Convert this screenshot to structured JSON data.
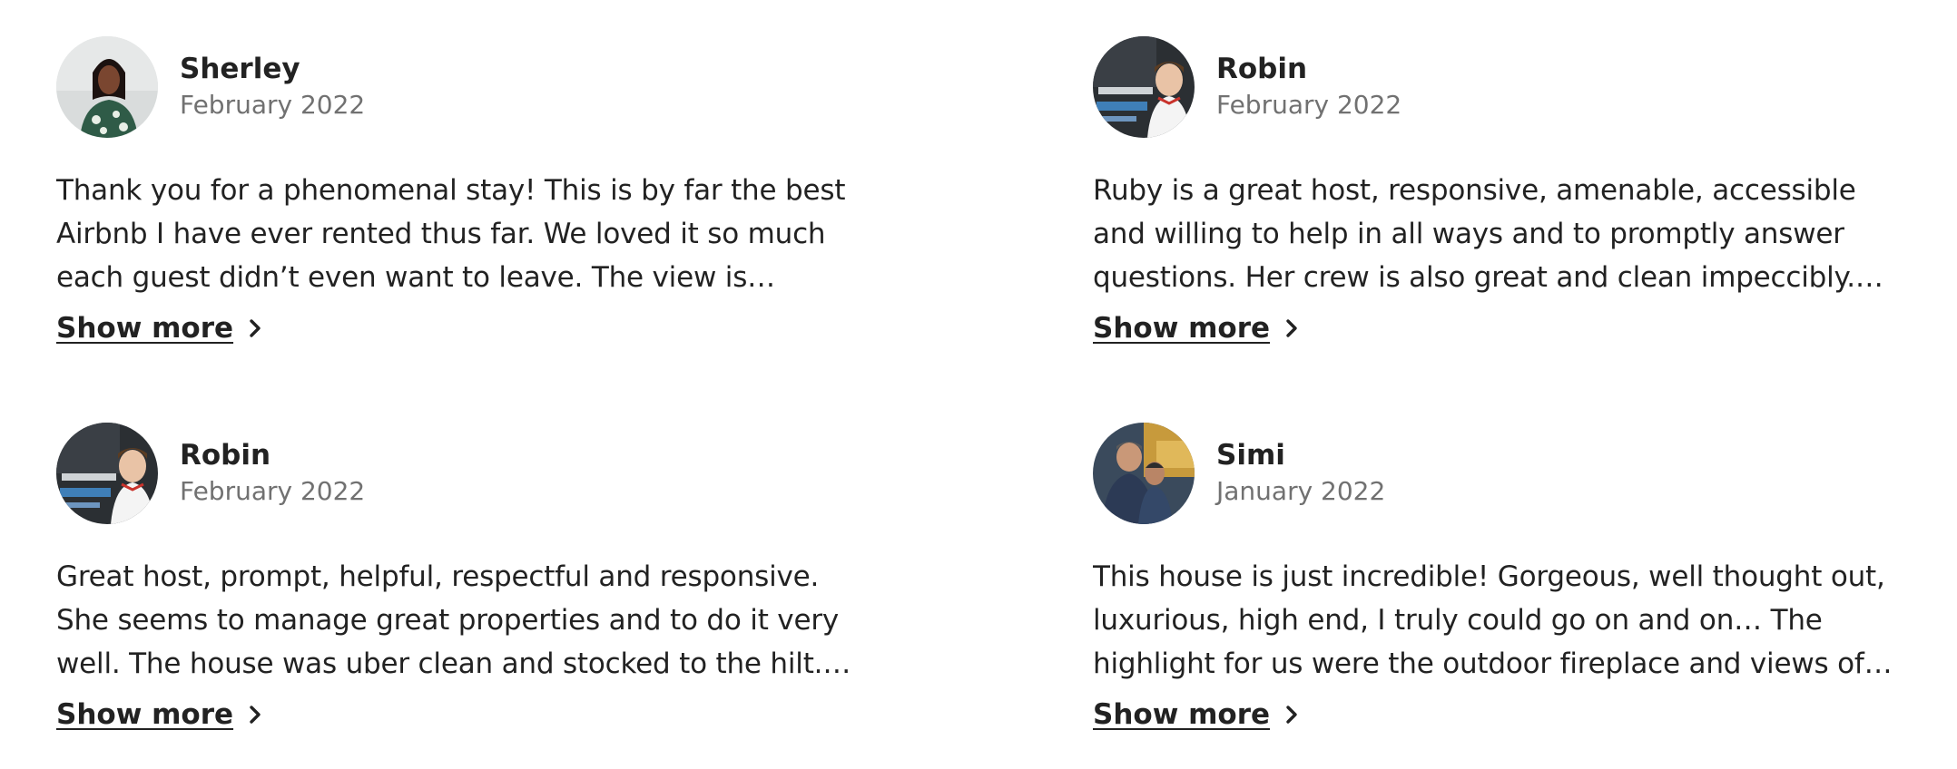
{
  "reviews": [
    {
      "name": "Sherley",
      "date": "February 2022",
      "text": "Thank you for a phenomenal stay! This is by far the best Airbnb I have ever rented thus far. We loved it so much each guest didn’t even want to leave. The view is spectacular + th…",
      "show_more": "Show more"
    },
    {
      "name": "Robin",
      "date": "February 2022",
      "text": "Ruby is a great host, responsive, amenable, accessible and willing to help in all ways and to promptly answer questions. Her crew is also great and clean impeccibly. You cannot go…",
      "show_more": "Show more"
    },
    {
      "name": "Robin",
      "date": "February 2022",
      "text": "Great host, prompt, helpful, respectful and responsive. She seems to manage great properties and to do it very well. The house was uber clean and stocked to the hilt. Ruby…",
      "show_more": "Show more"
    },
    {
      "name": "Simi",
      "date": "January 2022",
      "text": "This house is just incredible! Gorgeous, well thought out, luxurious, high end, I truly could go on and on… The highlight for us were the outdoor fireplace and views of Lake…",
      "show_more": "Show more"
    }
  ],
  "colors": {
    "text_primary": "#222222",
    "text_secondary": "#717171",
    "background": "#ffffff"
  },
  "icons": {
    "show_more": "chevron-right-icon"
  }
}
